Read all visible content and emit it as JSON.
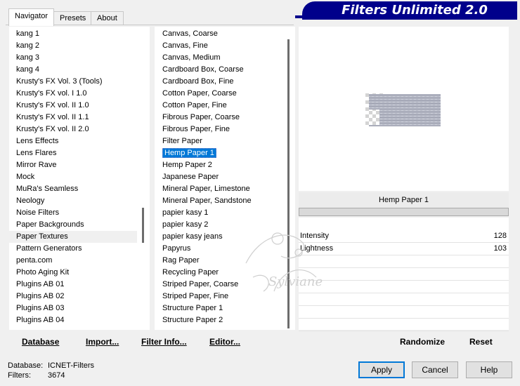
{
  "app": {
    "title": "Filters Unlimited 2.0"
  },
  "tabs": [
    {
      "label": "Navigator",
      "active": true
    },
    {
      "label": "Presets",
      "active": false
    },
    {
      "label": "About",
      "active": false
    }
  ],
  "categories": [
    "kang 1",
    "kang 2",
    "kang 3",
    "kang 4",
    "Krusty's FX Vol. 3 (Tools)",
    "Krusty's FX vol. I 1.0",
    "Krusty's FX vol. II 1.0",
    "Krusty's FX vol. II 1.1",
    "Krusty's FX vol. II 2.0",
    "Lens Effects",
    "Lens Flares",
    "Mirror Rave",
    "Mock",
    "MuRa's Seamless",
    "Neology",
    "Noise Filters",
    "Paper Backgrounds",
    "Paper Textures",
    "Pattern Generators",
    "penta.com",
    "Photo Aging Kit",
    "Plugins AB 01",
    "Plugins AB 02",
    "Plugins AB 03",
    "Plugins AB 04"
  ],
  "category_selected_index": 17,
  "filters": [
    "Canvas, Coarse",
    "Canvas, Fine",
    "Canvas, Medium",
    "Cardboard Box, Coarse",
    "Cardboard Box, Fine",
    "Cotton Paper, Coarse",
    "Cotton Paper, Fine",
    "Fibrous Paper, Coarse",
    "Fibrous Paper, Fine",
    "Filter Paper",
    "Hemp Paper 1",
    "Hemp Paper 2",
    "Japanese Paper",
    "Mineral Paper, Limestone",
    "Mineral Paper, Sandstone",
    "papier kasy 1",
    "papier kasy 2",
    "papier kasy jeans",
    "Papyrus",
    "Rag Paper",
    "Recycling Paper",
    "Striped Paper, Coarse",
    "Striped Paper, Fine",
    "Structure Paper 1",
    "Structure Paper 2"
  ],
  "filter_selected_index": 10,
  "preview": {
    "filter_name": "Hemp Paper 1"
  },
  "params": [
    {
      "label": "Intensity",
      "value": "128"
    },
    {
      "label": "Lightness",
      "value": "103"
    }
  ],
  "toolbar": {
    "database": "Database",
    "import": "Import...",
    "filter_info": "Filter Info...",
    "editor": "Editor...",
    "randomize": "Randomize",
    "reset": "Reset"
  },
  "status": {
    "database_label": "Database:",
    "database_value": "ICNET-Filters",
    "filters_label": "Filters:",
    "filters_value": "3674"
  },
  "buttons": {
    "apply": "Apply",
    "cancel": "Cancel",
    "help": "Help"
  },
  "watermark": {
    "text": "Sylviane"
  },
  "colors": {
    "banner": "#00008b",
    "selection": "#0078d7",
    "window": "#f0f0f0"
  }
}
